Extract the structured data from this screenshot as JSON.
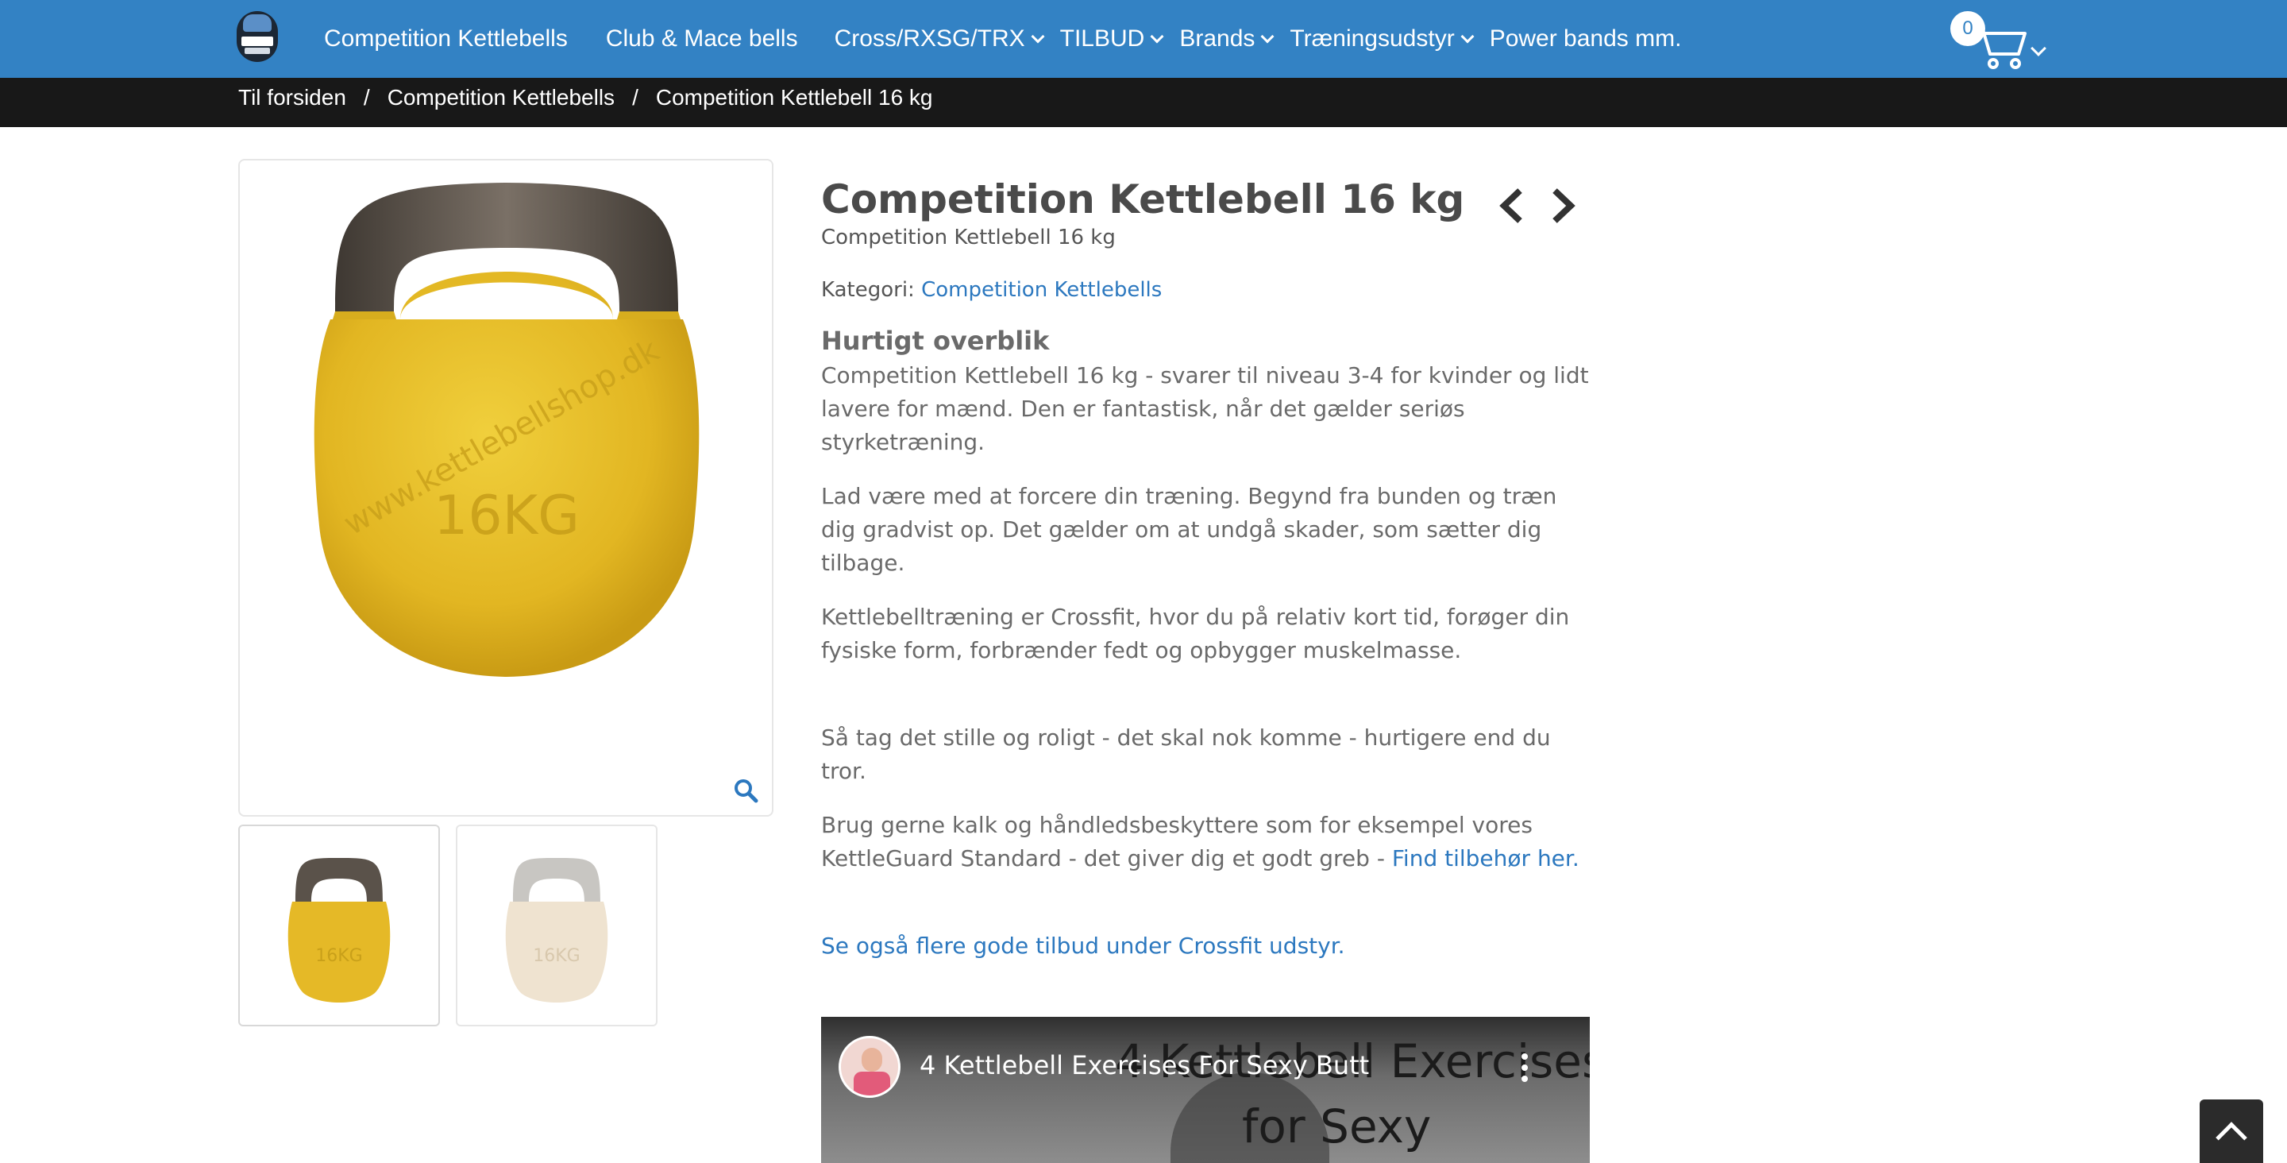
{
  "header": {
    "nav": [
      {
        "label": "Competition Kettlebells",
        "dropdown": false
      },
      {
        "label": "Club & Mace bells",
        "dropdown": false
      },
      {
        "label": "Cross/RXSG/TRX",
        "dropdown": true
      },
      {
        "label": "TILBUD",
        "dropdown": true
      },
      {
        "label": "Brands",
        "dropdown": true
      },
      {
        "label": "Træningsudstyr",
        "dropdown": true
      },
      {
        "label": "Power bands mm.",
        "dropdown": false
      }
    ],
    "cart_count": "0",
    "icons": {
      "logo": "kettlebell-logo",
      "cart": "cart-icon",
      "dropdown": "chevron-down-icon"
    }
  },
  "breadcrumb": {
    "home": "Til forsiden",
    "category": "Competition Kettlebells",
    "current": "Competition Kettlebell 16 kg",
    "separator": "/"
  },
  "gallery": {
    "main_image_label": "16KG",
    "main_image_text": "www.kettlebellshop.dk",
    "thumbnails": [
      {
        "label": "16KG",
        "color": "#e5b927",
        "active": true
      },
      {
        "label": "16KG",
        "color": "#efe3d0",
        "active": false
      }
    ]
  },
  "product": {
    "title": "Competition Kettlebell 16 kg",
    "subtitle": "Competition Kettlebell 16 kg",
    "category_label": "Kategori:",
    "category_link": "Competition Kettlebells",
    "overview_heading": "Hurtigt overblik",
    "paragraphs": {
      "p1": "Competition Kettlebell 16 kg - svarer til niveau 3-4 for kvinder og lidt lavere for mænd. Den er fantastisk, når det gælder seriøs styrketræning.",
      "p2": "Lad være med at forcere din træning. Begynd fra bunden og træn dig gradvist op. Det gælder om at undgå skader, som sætter dig tilbage.",
      "p3": "Kettlebelltræning er Crossfit, hvor du på relativ kort tid, forøger din fysiske form, forbrænder fedt og opbygger muskelmasse.",
      "p4": "Så tag det stille og roligt - det skal nok komme - hurtigere end du tror.",
      "p5_text": "Brug gerne kalk og håndledsbeskyttere som for eksempel vores KettleGuard Standard - det giver dig et godt greb - ",
      "p5_link": "Find tilbehør her."
    },
    "more_link": "Se også flere gode tilbud under Crossfit udstyr."
  },
  "video": {
    "title": "4 Kettlebell Exercises For Sexy Butt",
    "overlay_line1": "4 Kettlebell Exercises",
    "overlay_line2": "for Sexy"
  },
  "colors": {
    "nav_bg": "#3382c4",
    "breadcrumb_bg": "#181818",
    "link": "#2c78bf",
    "kettlebell_yellow": "#e5b927",
    "kettlebell_handle": "#5a524a"
  }
}
